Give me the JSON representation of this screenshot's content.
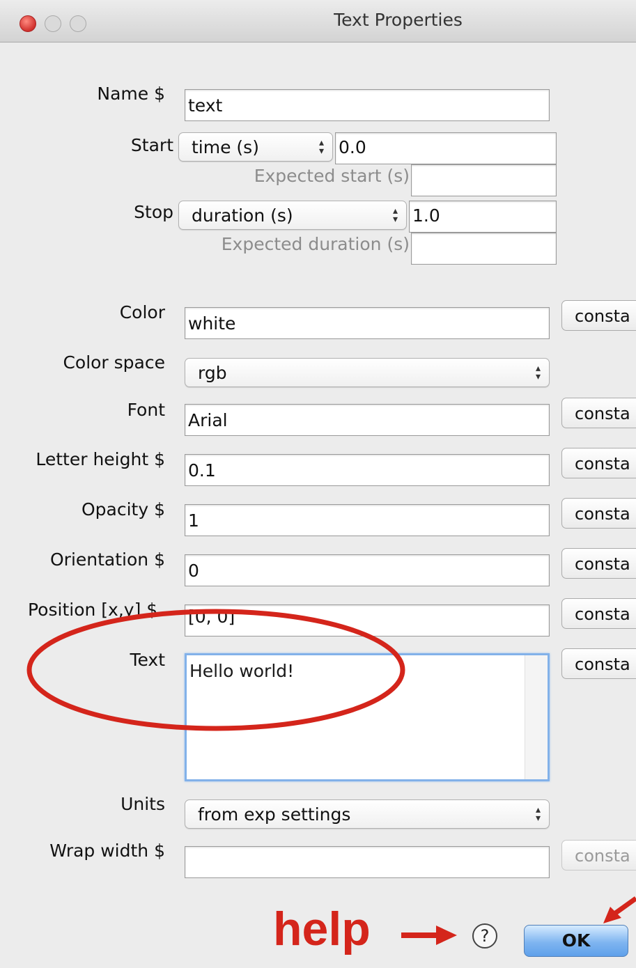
{
  "window": {
    "title": "Text Properties"
  },
  "fields": {
    "name": {
      "label": "Name $",
      "value": "text"
    },
    "start": {
      "label": "Start",
      "type": "time (s)",
      "value": "0.0",
      "expected_label": "Expected start (s)",
      "expected_value": ""
    },
    "stop": {
      "label": "Stop",
      "type": "duration (s)",
      "value": "1.0",
      "expected_label": "Expected duration (s)",
      "expected_value": ""
    },
    "color": {
      "label": "Color",
      "value": "white",
      "button": "consta"
    },
    "color_space": {
      "label": "Color space",
      "value": "rgb"
    },
    "font": {
      "label": "Font",
      "value": "Arial",
      "button": "consta"
    },
    "letter_height": {
      "label": "Letter height $",
      "value": "0.1",
      "button": "consta"
    },
    "opacity": {
      "label": "Opacity $",
      "value": "1",
      "button": "consta"
    },
    "orientation": {
      "label": "Orientation $",
      "value": "0",
      "button": "consta"
    },
    "position": {
      "label": "Position [x,y] $",
      "value": "[0, 0]",
      "button": "consta"
    },
    "text": {
      "label": "Text",
      "value": "Hello world!",
      "button": "consta"
    },
    "units": {
      "label": "Units",
      "value": "from exp settings"
    },
    "wrap_width": {
      "label": "Wrap width $",
      "value": "",
      "button": "consta"
    }
  },
  "footer": {
    "help_annotation": "help",
    "help_icon": "?",
    "ok": "OK"
  },
  "colors": {
    "annotation": "#d4251b",
    "ok_button": "#7fb5f0"
  }
}
